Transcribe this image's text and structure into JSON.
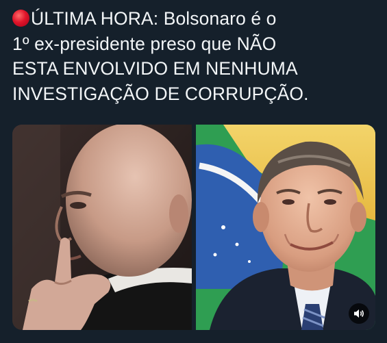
{
  "post": {
    "line1": "ÚLTIMA HORA: Bolsonaro é o",
    "line2": "1º ex-presidente preso que NÃO",
    "line3": "ESTA ENVOLVIDO EM NENHUMA",
    "line4": "INVESTIGAÇÃO DE CORRUPÇÃO."
  },
  "media": {
    "left_photo_icon": "person-thinking-photo",
    "right_photo_icon": "person-smiling-flag-photo",
    "audio_icon": "speaker-icon"
  },
  "colors": {
    "background": "#15202b",
    "text": "#f2f5f7",
    "alert_dot": "#e0152a"
  }
}
